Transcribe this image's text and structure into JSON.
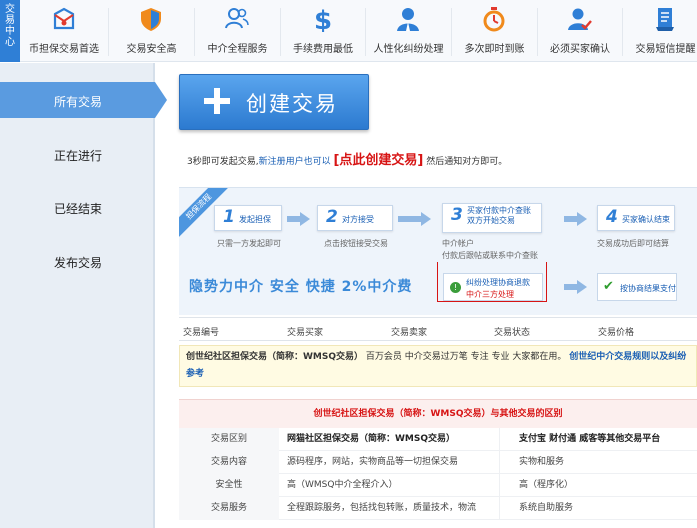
{
  "sidebar_tab": {
    "label": [
      "交",
      "易",
      "中",
      "心"
    ]
  },
  "features": [
    {
      "icon": "envelope-shield-icon",
      "label": "币担保交易首选",
      "color": "#2f7fd6"
    },
    {
      "icon": "shield-icon",
      "label": "交易安全高",
      "color": "#f08a1c"
    },
    {
      "icon": "people-icon",
      "label": "中介全程服务",
      "color": "#2f7fd6"
    },
    {
      "icon": "dollar-icon",
      "label": "手续费用最低",
      "color": "#2f7fd6"
    },
    {
      "icon": "person-icon",
      "label": "人性化纠纷处理",
      "color": "#2f7fd6"
    },
    {
      "icon": "stopwatch-icon",
      "label": "多次即时到账",
      "color": "#f08a1c"
    },
    {
      "icon": "person-check-icon",
      "label": "必须买家确认",
      "color": "#2f7fd6"
    },
    {
      "icon": "document-icon",
      "label": "交易短信提醒",
      "color": "#2f7fd6"
    }
  ],
  "nav": {
    "items": [
      {
        "label": "所有交易",
        "active": true
      },
      {
        "label": "正在进行",
        "active": false
      },
      {
        "label": "已经结束",
        "active": false
      },
      {
        "label": "发布交易",
        "active": false
      }
    ]
  },
  "create_button": {
    "label": "创建交易"
  },
  "hint": {
    "prefix": "3秒即可发起交易,",
    "middle": "新注册用户也可以",
    "link": "[点此创建交易]",
    "suffix": "然后通知对方即可。"
  },
  "process": {
    "ribbon": "担保流程",
    "steps": [
      {
        "num": "1",
        "label": "发起担保",
        "caption": "只需一方发起即可"
      },
      {
        "num": "2",
        "label": "对方接受",
        "caption": "点击按钮接受交易"
      },
      {
        "num": "3",
        "label": "买家付款中介查账\n双方开始交易",
        "caption": "中介帐户\n付款后跟帖或联系中介查账"
      },
      {
        "num": "4",
        "label": "买家确认结束",
        "caption": "交易成功后即可结算"
      }
    ],
    "slogan": "隐势力中介  安全 快捷  2%中介费",
    "dispute": {
      "line1": "纠纷处理协商退款",
      "line2": "中介三方处理"
    },
    "final": "按协商结果支付"
  },
  "table_header": [
    "交易编号",
    "交易买家",
    "交易卖家",
    "交易状态",
    "交易价格"
  ],
  "notice": {
    "bold": "创世纪社区担保交易（简称：WMSQ交易）",
    "text": "百万会员 中介交易过万笔 专注 专业 大家都在用。",
    "link": "创世纪中介交易规则以及纠纷参考"
  },
  "comparison": {
    "title": "创世纪社区担保交易（简称：WMSQ交易）与其他交易的区别",
    "rows": [
      {
        "c0": "交易区别",
        "c1": "网猫社区担保交易（简称：WMSQ交易）",
        "c2": "支付宝 财付通 威客等其他交易平台",
        "hdr": true
      },
      {
        "c0": "交易内容",
        "c1": "源码程序，网站，实物商品等一切担保交易",
        "c2": "实物和服务",
        "hdr": false
      },
      {
        "c0": "安全性",
        "c1": "高（WMSQ中介全程介入）",
        "c2": "高（程序化）",
        "hdr": false
      },
      {
        "c0": "交易服务",
        "c1": "全程跟踪服务，包括找包转账，质量技术，物流",
        "c2": "系统自助服务",
        "hdr": false
      }
    ]
  }
}
